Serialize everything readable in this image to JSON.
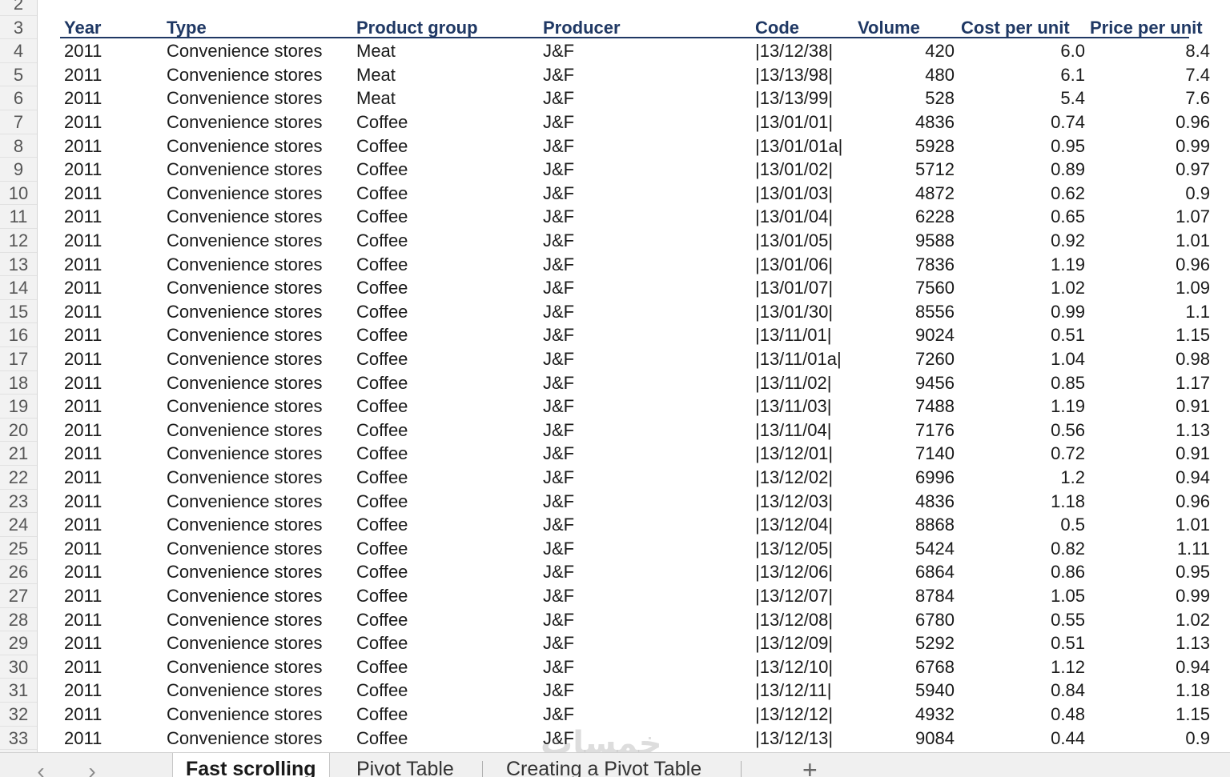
{
  "spreadsheet": {
    "row_numbers": [
      "2",
      "3",
      "4",
      "5",
      "6",
      "7",
      "8",
      "9",
      "10",
      "11",
      "12",
      "13",
      "14",
      "15",
      "16",
      "17",
      "18",
      "19",
      "20",
      "21",
      "22",
      "23",
      "24",
      "25",
      "26",
      "27",
      "28",
      "29",
      "30",
      "31",
      "32",
      "33"
    ],
    "headers": {
      "year": "Year",
      "type": "Type",
      "product_group": "Product group",
      "producer": "Producer",
      "code": "Code",
      "volume": "Volume",
      "cost_per_unit": "Cost per unit",
      "price_per_unit": "Price per unit"
    },
    "rows": [
      [
        "2011",
        "Convenience stores",
        "Meat",
        "J&F",
        "|13/12/38|",
        "420",
        "6.0",
        "8.4"
      ],
      [
        "2011",
        "Convenience stores",
        "Meat",
        "J&F",
        "|13/13/98|",
        "480",
        "6.1",
        "7.4"
      ],
      [
        "2011",
        "Convenience stores",
        "Meat",
        "J&F",
        "|13/13/99|",
        "528",
        "5.4",
        "7.6"
      ],
      [
        "2011",
        "Convenience stores",
        "Coffee",
        "J&F",
        "|13/01/01|",
        "4836",
        "0.74",
        "0.96"
      ],
      [
        "2011",
        "Convenience stores",
        "Coffee",
        "J&F",
        "|13/01/01a|",
        "5928",
        "0.95",
        "0.99"
      ],
      [
        "2011",
        "Convenience stores",
        "Coffee",
        "J&F",
        "|13/01/02|",
        "5712",
        "0.89",
        "0.97"
      ],
      [
        "2011",
        "Convenience stores",
        "Coffee",
        "J&F",
        "|13/01/03|",
        "4872",
        "0.62",
        "0.9"
      ],
      [
        "2011",
        "Convenience stores",
        "Coffee",
        "J&F",
        "|13/01/04|",
        "6228",
        "0.65",
        "1.07"
      ],
      [
        "2011",
        "Convenience stores",
        "Coffee",
        "J&F",
        "|13/01/05|",
        "9588",
        "0.92",
        "1.01"
      ],
      [
        "2011",
        "Convenience stores",
        "Coffee",
        "J&F",
        "|13/01/06|",
        "7836",
        "1.19",
        "0.96"
      ],
      [
        "2011",
        "Convenience stores",
        "Coffee",
        "J&F",
        "|13/01/07|",
        "7560",
        "1.02",
        "1.09"
      ],
      [
        "2011",
        "Convenience stores",
        "Coffee",
        "J&F",
        "|13/01/30|",
        "8556",
        "0.99",
        "1.1"
      ],
      [
        "2011",
        "Convenience stores",
        "Coffee",
        "J&F",
        "|13/11/01|",
        "9024",
        "0.51",
        "1.15"
      ],
      [
        "2011",
        "Convenience stores",
        "Coffee",
        "J&F",
        "|13/11/01a|",
        "7260",
        "1.04",
        "0.98"
      ],
      [
        "2011",
        "Convenience stores",
        "Coffee",
        "J&F",
        "|13/11/02|",
        "9456",
        "0.85",
        "1.17"
      ],
      [
        "2011",
        "Convenience stores",
        "Coffee",
        "J&F",
        "|13/11/03|",
        "7488",
        "1.19",
        "0.91"
      ],
      [
        "2011",
        "Convenience stores",
        "Coffee",
        "J&F",
        "|13/11/04|",
        "7176",
        "0.56",
        "1.13"
      ],
      [
        "2011",
        "Convenience stores",
        "Coffee",
        "J&F",
        "|13/12/01|",
        "7140",
        "0.72",
        "0.91"
      ],
      [
        "2011",
        "Convenience stores",
        "Coffee",
        "J&F",
        "|13/12/02|",
        "6996",
        "1.2",
        "0.94"
      ],
      [
        "2011",
        "Convenience stores",
        "Coffee",
        "J&F",
        "|13/12/03|",
        "4836",
        "1.18",
        "0.96"
      ],
      [
        "2011",
        "Convenience stores",
        "Coffee",
        "J&F",
        "|13/12/04|",
        "8868",
        "0.5",
        "1.01"
      ],
      [
        "2011",
        "Convenience stores",
        "Coffee",
        "J&F",
        "|13/12/05|",
        "5424",
        "0.82",
        "1.11"
      ],
      [
        "2011",
        "Convenience stores",
        "Coffee",
        "J&F",
        "|13/12/06|",
        "6864",
        "0.86",
        "0.95"
      ],
      [
        "2011",
        "Convenience stores",
        "Coffee",
        "J&F",
        "|13/12/07|",
        "8784",
        "1.05",
        "0.99"
      ],
      [
        "2011",
        "Convenience stores",
        "Coffee",
        "J&F",
        "|13/12/08|",
        "6780",
        "0.55",
        "1.02"
      ],
      [
        "2011",
        "Convenience stores",
        "Coffee",
        "J&F",
        "|13/12/09|",
        "5292",
        "0.51",
        "1.13"
      ],
      [
        "2011",
        "Convenience stores",
        "Coffee",
        "J&F",
        "|13/12/10|",
        "6768",
        "1.12",
        "0.94"
      ],
      [
        "2011",
        "Convenience stores",
        "Coffee",
        "J&F",
        "|13/12/11|",
        "5940",
        "0.84",
        "1.18"
      ],
      [
        "2011",
        "Convenience stores",
        "Coffee",
        "J&F",
        "|13/12/12|",
        "4932",
        "0.48",
        "1.15"
      ],
      [
        "2011",
        "Convenience stores",
        "Coffee",
        "J&F",
        "|13/12/13|",
        "9084",
        "0.44",
        "0.9"
      ]
    ]
  },
  "sheet_tabs": {
    "prev_icon": "chevron-left-icon",
    "next_icon": "chevron-right-icon",
    "tabs": [
      "Fast scrolling",
      "Pivot Table",
      "Creating a Pivot Table"
    ],
    "active_index": 0,
    "add_icon": "plus-icon"
  },
  "watermark": "خمسات",
  "colors": {
    "header_text": "#1f3864",
    "header_rule": "#1f3864",
    "active_tab_accent": "#1e7145"
  }
}
